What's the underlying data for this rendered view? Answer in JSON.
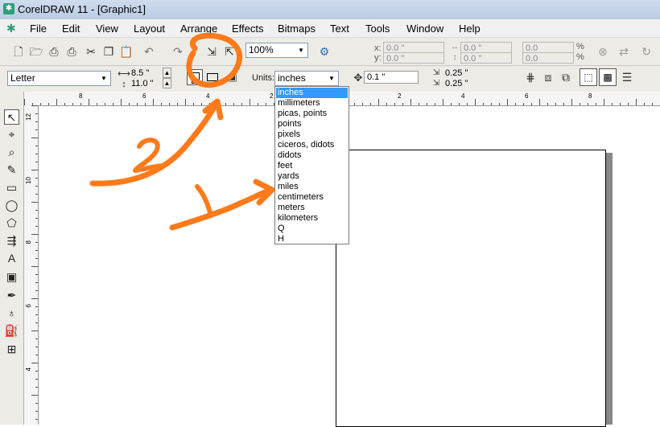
{
  "window": {
    "title": "CorelDRAW 11 - [Graphic1]"
  },
  "menu": [
    "File",
    "Edit",
    "View",
    "Layout",
    "Arrange",
    "Effects",
    "Bitmaps",
    "Text",
    "Tools",
    "Window",
    "Help"
  ],
  "toolbar": {
    "zoom": "100%",
    "pos_x_label": "x:",
    "pos_x": "0.0 \"",
    "pos_y_label": "y:",
    "pos_y": "0.0 \"",
    "size_w": "0.0 \"",
    "size_h": "0.0 \"",
    "scale_w": "0.0",
    "scale_h": "0.0",
    "pct": "%"
  },
  "property_bar": {
    "paper_size": "Letter",
    "page_width": "8.5 \"",
    "page_height": "11.0 \"",
    "units_label": "Units:",
    "units_value": "inches",
    "nudge": "0.1 \"",
    "dup_x": "0.25 \"",
    "dup_y": "0.25 \""
  },
  "units_dropdown": {
    "options": [
      "inches",
      "millimeters",
      "picas, points",
      "points",
      "pixels",
      "ciceros, didots",
      "didots",
      "feet",
      "yards",
      "miles",
      "centimeters",
      "meters",
      "kilometers",
      "Q",
      "H"
    ],
    "selected": "inches"
  },
  "ruler": {
    "top_labels": [
      "8",
      "6",
      "4",
      "2",
      "2",
      "4",
      "6",
      "8"
    ],
    "left_labels": [
      "12",
      "10",
      "8",
      "6",
      "4"
    ]
  },
  "annotations": {
    "label_1": "1",
    "label_2": "2",
    "color": "#ff7a1a"
  },
  "colors": {
    "selection": "#3399ff",
    "titlebar": "#c4d4ea",
    "annotation": "#ff7a1a"
  }
}
